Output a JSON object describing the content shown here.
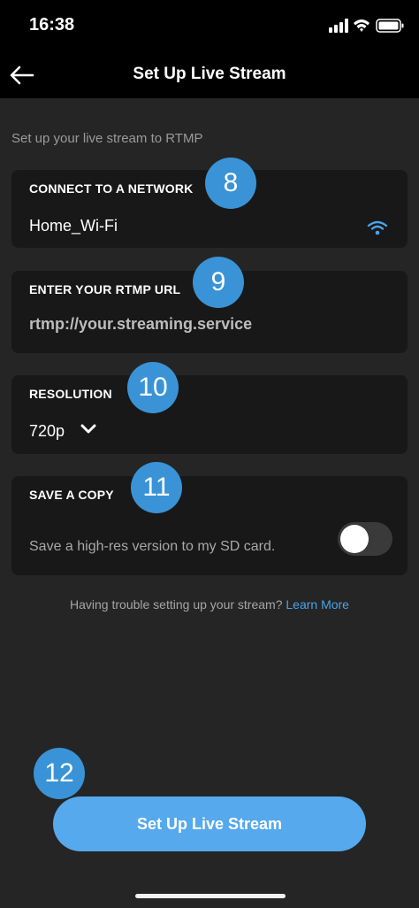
{
  "status_bar": {
    "time": "16:38"
  },
  "header": {
    "title": "Set Up Live Stream"
  },
  "intro": "Set up your live stream to RTMP",
  "network": {
    "title": "CONNECT TO A NETWORK",
    "value": "Home_Wi-Fi",
    "badge": "8"
  },
  "rtmp": {
    "title": "ENTER YOUR RTMP URL",
    "placeholder": "rtmp://your.streaming.service",
    "badge": "9"
  },
  "resolution": {
    "title": "RESOLUTION",
    "value": "720p",
    "badge": "10"
  },
  "save_copy": {
    "title": "SAVE A COPY",
    "description": "Save a high-res version to my SD card.",
    "enabled": false,
    "badge": "11"
  },
  "help": {
    "text": "Having trouble setting up your stream?",
    "link": "Learn More"
  },
  "cta": {
    "label": "Set Up Live Stream",
    "badge": "12"
  },
  "colors": {
    "accent": "#55a9ec",
    "badge": "#3a93d6",
    "card": "#181818",
    "background": "#252525"
  }
}
